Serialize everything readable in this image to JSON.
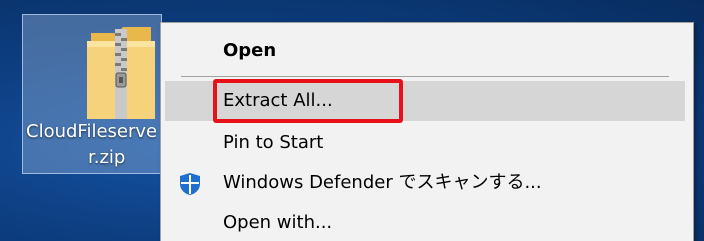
{
  "desktop": {
    "file_label_line1": "CloudFileserve",
    "file_label_line2": "r.zip",
    "selection_color": "#8caad2"
  },
  "context_menu": {
    "items": [
      {
        "label": "Open",
        "bold": true
      },
      {
        "label": "Extract All...",
        "highlighted": true
      },
      {
        "label": "Pin to Start"
      },
      {
        "label": "Windows Defender でスキャンする...",
        "icon": "windows-defender-shield-icon"
      },
      {
        "label": "Open with..."
      }
    ],
    "highlight_color": "#e8101a"
  }
}
